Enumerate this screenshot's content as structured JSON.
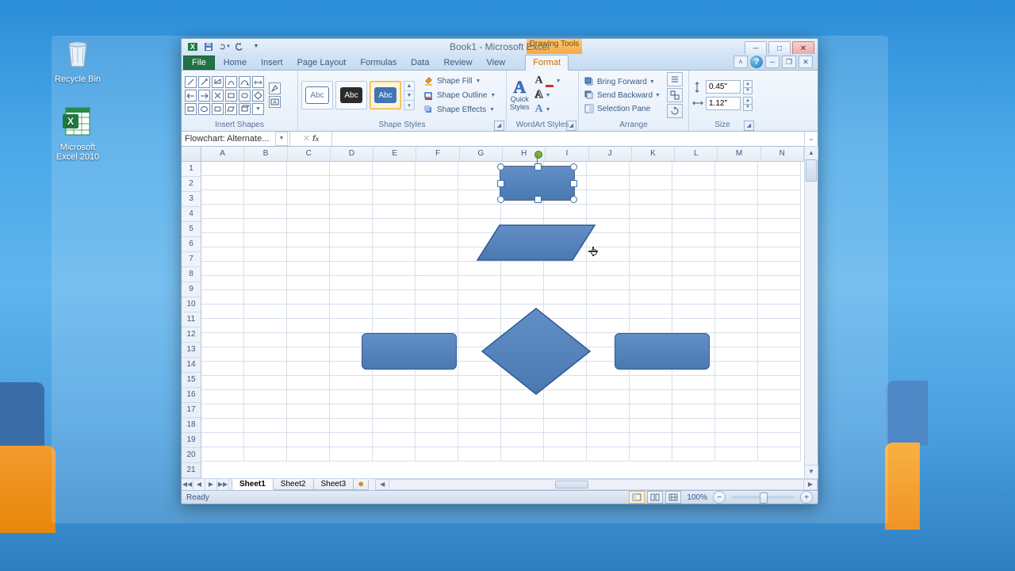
{
  "desktop": {
    "recycle": "Recycle Bin",
    "excel": "Microsoft\nExcel 2010"
  },
  "title": "Book1 - Microsoft Excel",
  "contextualTab": "Drawing Tools",
  "contextualSub": "Format",
  "tabs": {
    "file": "File",
    "home": "Home",
    "insert": "Insert",
    "pagelayout": "Page Layout",
    "formulas": "Formulas",
    "data": "Data",
    "review": "Review",
    "view": "View",
    "format": "Format"
  },
  "ribbon": {
    "insertShapes": "Insert Shapes",
    "shapeStyles": "Shape Styles",
    "wordArt": "WordArt Styles",
    "arrange": "Arrange",
    "size": "Size",
    "abc": "Abc",
    "shapeFill": "Shape Fill",
    "shapeOutline": "Shape Outline",
    "shapeEffects": "Shape Effects",
    "quickStyles": "Quick\nStyles",
    "bringForward": "Bring Forward",
    "sendBackward": "Send Backward",
    "selectionPane": "Selection Pane",
    "height": "0.45\"",
    "width": "1.12\""
  },
  "namebox": "Flowchart: Alternate...",
  "columns": [
    "A",
    "B",
    "C",
    "D",
    "E",
    "F",
    "G",
    "H",
    "I",
    "J",
    "K",
    "L",
    "M",
    "N"
  ],
  "rows": [
    "1",
    "2",
    "3",
    "4",
    "5",
    "6",
    "7",
    "8",
    "9",
    "10",
    "11",
    "12",
    "13",
    "14",
    "15",
    "16",
    "17",
    "18",
    "19",
    "20",
    "21"
  ],
  "sheets": {
    "s1": "Sheet1",
    "s2": "Sheet2",
    "s3": "Sheet3"
  },
  "status": "Ready",
  "zoom": "100%"
}
